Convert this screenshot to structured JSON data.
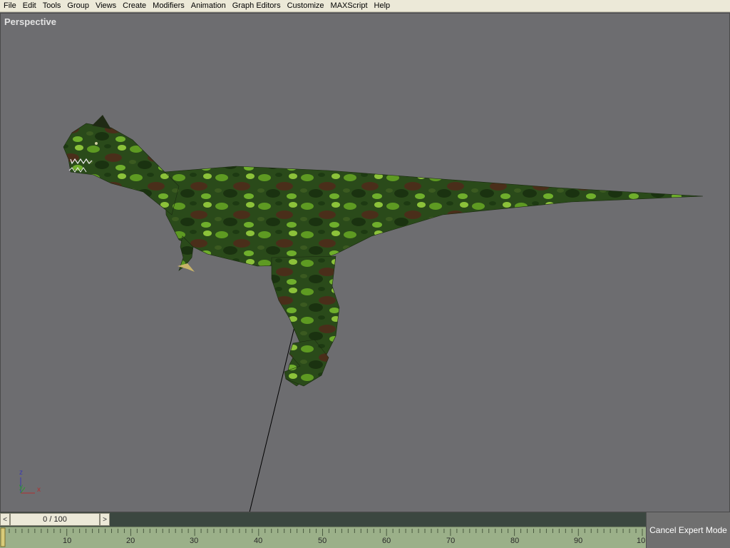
{
  "menu": {
    "items": [
      "File",
      "Edit",
      "Tools",
      "Group",
      "Views",
      "Create",
      "Modifiers",
      "Animation",
      "Graph Editors",
      "Customize",
      "MAXScript",
      "Help"
    ]
  },
  "viewport": {
    "label": "Perspective",
    "axes": {
      "z": "z",
      "y": "y",
      "x": "x"
    }
  },
  "timeline": {
    "prev_arrow": "<",
    "next_arrow": ">",
    "slider_value": "0 / 100",
    "ruler_labels": [
      "10",
      "20",
      "30",
      "40",
      "50",
      "60",
      "70",
      "80",
      "90",
      "10"
    ]
  },
  "expert_button": {
    "label": "Cancel Expert Mode"
  },
  "colors": {
    "viewport_bg": "#6d6d70",
    "menubar_bg": "#ece9d8",
    "ruler_bg": "#9bb089",
    "dino_dark": "#1f3a16",
    "dino_mid": "#3c6b1e",
    "dino_light": "#7fbf2a"
  }
}
